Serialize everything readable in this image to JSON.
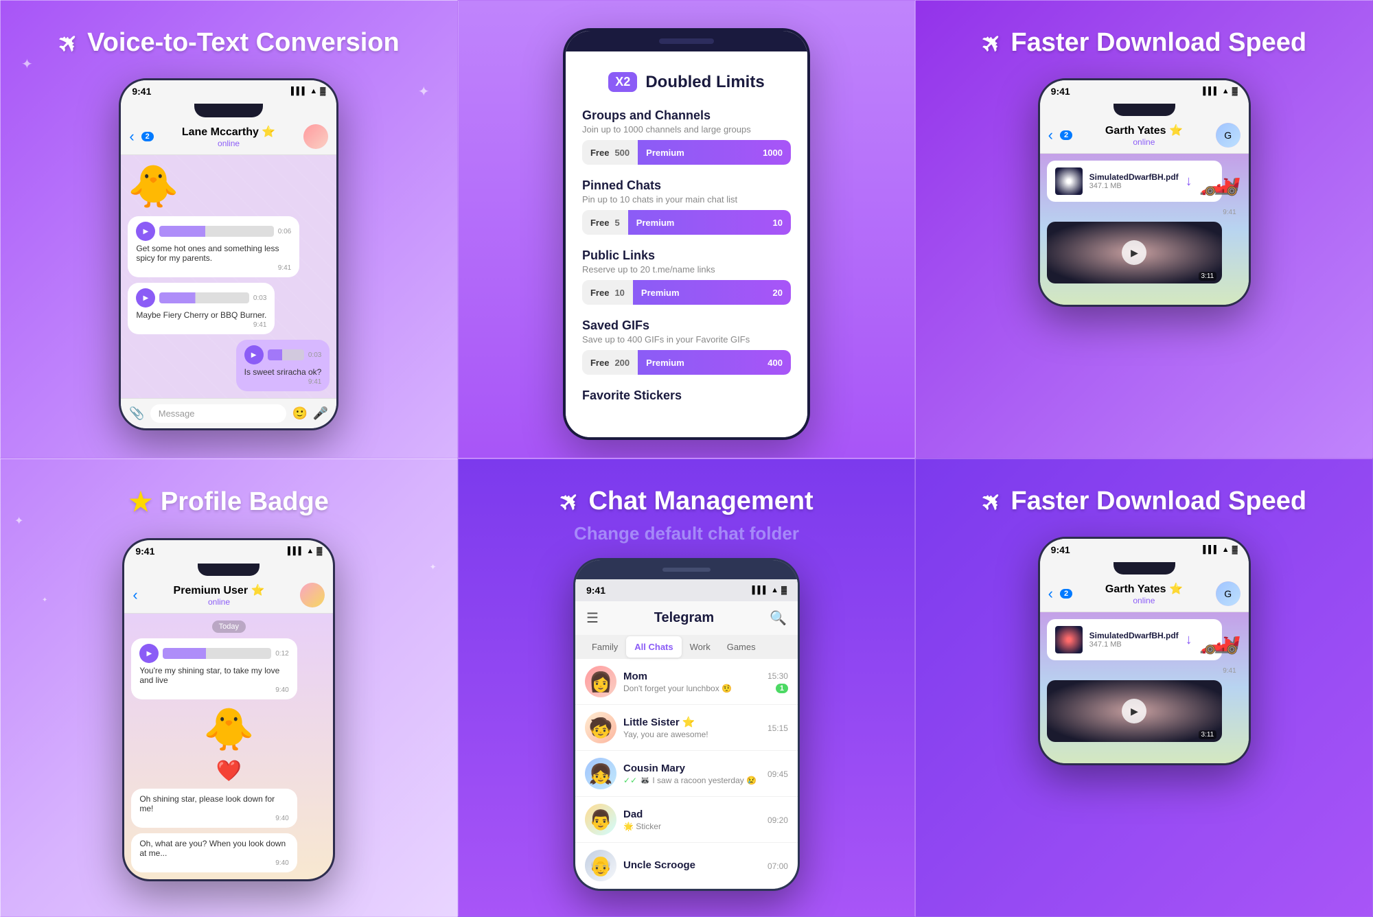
{
  "cells": {
    "cell1": {
      "title": "Voice-to-Text Conversion",
      "icon": "telegram",
      "contact": "Lane Mccarthy",
      "status": "online",
      "time": "9:41",
      "messages": [
        {
          "type": "voice",
          "text": "Get some hot ones and something less spicy for my parents.",
          "duration": "0:06",
          "time": "9:41",
          "sent": true
        },
        {
          "type": "voice",
          "text": "Maybe Fiery Cherry or BBQ Burner.",
          "duration": "0:03",
          "time": "9:41",
          "sent": true
        },
        {
          "type": "voice",
          "text": "Is sweet sriracha ok?",
          "duration": "0:03",
          "time": "9:41",
          "sent": false
        }
      ],
      "inputPlaceholder": "Message"
    },
    "cell2": {
      "title": "Doubled Limits",
      "badge": "X2",
      "limits": [
        {
          "name": "Groups and Channels",
          "desc": "Join up to 1000 channels and large groups",
          "free": 500,
          "premium": 1000
        },
        {
          "name": "Pinned Chats",
          "desc": "Pin up to 10 chats in your main chat list",
          "free": 5,
          "premium": 10
        },
        {
          "name": "Public Links",
          "desc": "Reserve up to 20 t.me/name links",
          "free": 10,
          "premium": 20
        },
        {
          "name": "Saved GIFs",
          "desc": "Save up to 400 GIFs in your Favorite GIFs",
          "free": 200,
          "premium": 400
        },
        {
          "name": "Favorite Stickers",
          "desc": "",
          "free": "",
          "premium": ""
        }
      ]
    },
    "cell3": {
      "title": "Faster Download Speed",
      "icon": "telegram",
      "contact": "Garth Yates",
      "status": "online",
      "time": "9:41",
      "fileName": "SimulatedDwarfBH.pdf",
      "fileSize": "347.1 MB",
      "videoTime": "3:11"
    },
    "cell4": {
      "title": "Profile Badge",
      "icon": "star",
      "contact": "Premium User",
      "status": "online",
      "time": "9:41",
      "todayLabel": "Today",
      "messages": [
        {
          "text": "You're my shining star, to take my love and live",
          "time": "9:40",
          "sent": true
        },
        {
          "text": "Oh shining star, please look down for me!",
          "time": "9:40",
          "sent": false
        },
        {
          "text": "Oh, what are you? When you look down at me...",
          "time": "9:40",
          "sent": false
        }
      ]
    },
    "cell5": {
      "title": "Chat Management",
      "subtitle": "Change default chat folder",
      "icon": "telegram",
      "appTitle": "Telegram",
      "tabs": [
        "Family",
        "All Chats",
        "Work",
        "Games"
      ],
      "activeTab": "All Chats",
      "chats": [
        {
          "name": "Mom",
          "preview": "Don't forget your lunchbox 🤨",
          "time": "15:30",
          "badge": "1",
          "emoji": "👩"
        },
        {
          "name": "Little Sister ⭐",
          "preview": "Yay, you are awesome!",
          "time": "15:15",
          "badge": "",
          "emoji": "🧒"
        },
        {
          "name": "Cousin Mary",
          "preview": "🦝 I saw a racoon yesterday 😢",
          "time": "09:45",
          "badge": "",
          "emoji": "👧",
          "check": true
        },
        {
          "name": "Dad",
          "preview": "🌟 Sticker",
          "time": "09:20",
          "badge": "",
          "emoji": "👨"
        },
        {
          "name": "Uncle Scrooge",
          "preview": "",
          "time": "07:00",
          "badge": "",
          "emoji": "👴"
        }
      ]
    },
    "cell6": {
      "title": "Faster Download Speed",
      "icon": "telegram",
      "contact": "Garth Yates",
      "status": "online",
      "time": "9:41",
      "fileName": "SimulatedDwarfBH.pdf",
      "fileSize": "347.1 MB",
      "videoTime": "3:11"
    }
  },
  "icons": {
    "telegram": "✈",
    "star": "★",
    "back": "‹",
    "menu": "☰",
    "search": "🔍",
    "mic": "🎤",
    "attach": "📎",
    "emoji": "🙂"
  }
}
